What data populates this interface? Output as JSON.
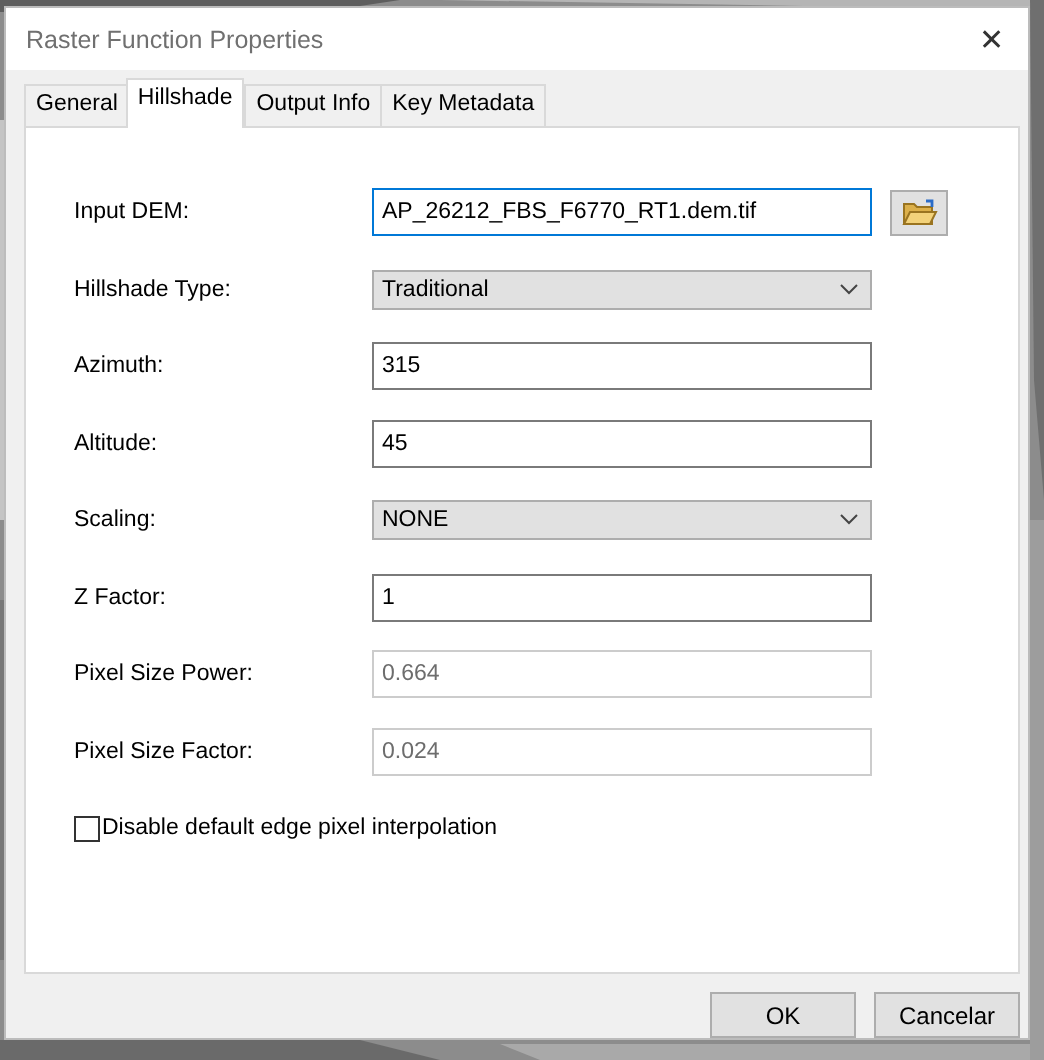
{
  "window": {
    "title": "Raster Function Properties",
    "close": "✕"
  },
  "tabs": [
    {
      "label": "General",
      "selected": false
    },
    {
      "label": "Hillshade",
      "selected": true
    },
    {
      "label": "Output Info",
      "selected": false
    },
    {
      "label": "Key Metadata",
      "selected": false
    }
  ],
  "fields": [
    {
      "label": "Input DEM:",
      "kind": "text",
      "value": "AP_26212_FBS_F6770_RT1.dem.tif",
      "disabled": false,
      "focused": true,
      "browse": true
    },
    {
      "label": "Hillshade Type:",
      "kind": "dropdown",
      "value": "Traditional",
      "disabled": false,
      "focused": false,
      "browse": false
    },
    {
      "label": "Azimuth:",
      "kind": "text",
      "value": "315",
      "disabled": false,
      "focused": false,
      "browse": false
    },
    {
      "label": "Altitude:",
      "kind": "text",
      "value": "45",
      "disabled": false,
      "focused": false,
      "browse": false
    },
    {
      "label": "Scaling:",
      "kind": "dropdown",
      "value": "NONE",
      "disabled": false,
      "focused": false,
      "browse": false
    },
    {
      "label": "Z Factor:",
      "kind": "text",
      "value": "1",
      "disabled": false,
      "focused": false,
      "browse": false
    },
    {
      "label": "Pixel Size Power:",
      "kind": "text",
      "value": "0.664",
      "disabled": true,
      "focused": false,
      "browse": false
    },
    {
      "label": "Pixel Size Factor:",
      "kind": "text",
      "value": "0.024",
      "disabled": true,
      "focused": false,
      "browse": false
    }
  ],
  "checkbox": {
    "label": "Disable default edge pixel interpolation",
    "checked": false
  },
  "buttons": [
    "OK",
    "Cancelar"
  ]
}
